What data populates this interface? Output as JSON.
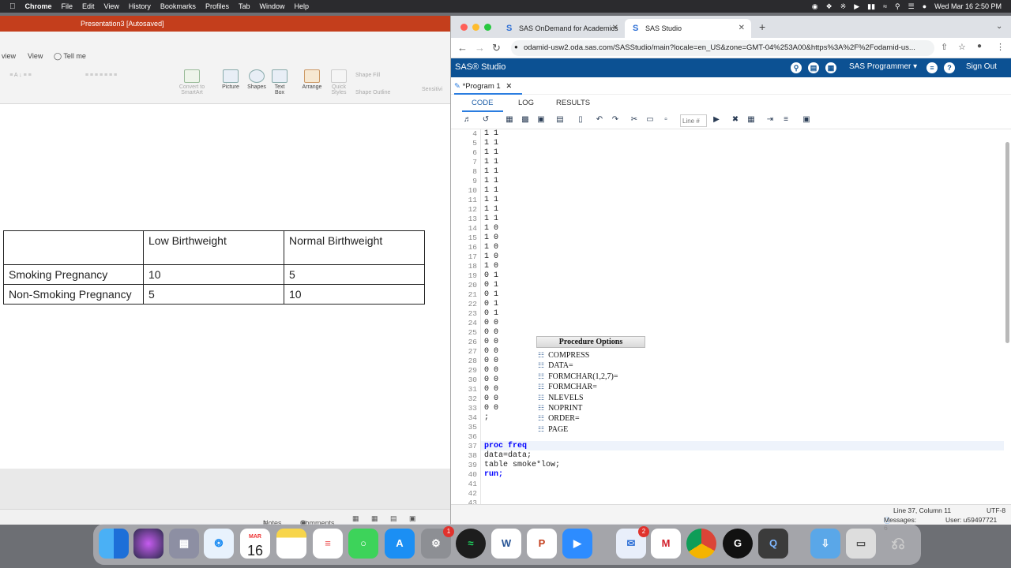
{
  "menubar": {
    "app": "Chrome",
    "items": [
      "File",
      "Edit",
      "View",
      "History",
      "Bookmarks",
      "Profiles",
      "Tab",
      "Window",
      "Help"
    ],
    "clock": "Wed Mar 16  2:50 PM"
  },
  "ppt": {
    "title": "Presentation3 [Autosaved]",
    "tabs": [
      "view",
      "View",
      "Tell me"
    ],
    "ribbon": {
      "convert_smartart": "Convert to SmartArt",
      "picture": "Picture",
      "shapes": "Shapes",
      "text_box": "Text Box",
      "arrange": "Arrange",
      "quick_styles": "Quick Styles",
      "shape_fill": "Shape Fill",
      "shape_outline": "Shape Outline",
      "sensitivity": "Sensitivi"
    },
    "table": {
      "headers": [
        "",
        "Low Birthweight",
        "Normal Birthweight"
      ],
      "rows": [
        [
          "Smoking Pregnancy",
          "10",
          "5"
        ],
        [
          "Non-Smoking Pregnancy",
          "5",
          "10"
        ]
      ]
    },
    "status": {
      "notes": "Notes",
      "comments": "Comments"
    }
  },
  "chrome": {
    "tabs": [
      {
        "label": "SAS OnDemand for Academics"
      },
      {
        "label": "SAS Studio"
      }
    ],
    "url": "odamid-usw2.oda.sas.com/SASStudio/main?locale=en_US&zone=GMT-04%253A00&https%3A%2F%2Fodamid-us..."
  },
  "sas": {
    "logo": "SAS® Studio",
    "role": "SAS Programmer",
    "signout": "Sign Out",
    "program_tab": "*Program 1",
    "subtabs": [
      "CODE",
      "LOG",
      "RESULTS"
    ],
    "line_placeholder": "Line #",
    "lines": [
      {
        "n": "4",
        "t": "1 1"
      },
      {
        "n": "5",
        "t": "1 1"
      },
      {
        "n": "6",
        "t": "1 1"
      },
      {
        "n": "7",
        "t": "1 1"
      },
      {
        "n": "8",
        "t": "1 1"
      },
      {
        "n": "9",
        "t": "1 1"
      },
      {
        "n": "10",
        "t": "1 1"
      },
      {
        "n": "11",
        "t": "1 1"
      },
      {
        "n": "12",
        "t": "1 1"
      },
      {
        "n": "13",
        "t": "1 1"
      },
      {
        "n": "14",
        "t": "1 0"
      },
      {
        "n": "15",
        "t": "1 0"
      },
      {
        "n": "16",
        "t": "1 0"
      },
      {
        "n": "17",
        "t": "1 0"
      },
      {
        "n": "18",
        "t": "1 0"
      },
      {
        "n": "19",
        "t": "0 1"
      },
      {
        "n": "20",
        "t": "0 1"
      },
      {
        "n": "21",
        "t": "0 1"
      },
      {
        "n": "22",
        "t": "0 1"
      },
      {
        "n": "23",
        "t": "0 1"
      },
      {
        "n": "24",
        "t": "0 0"
      },
      {
        "n": "25",
        "t": "0 0"
      },
      {
        "n": "26",
        "t": "0 0"
      },
      {
        "n": "27",
        "t": "0 0"
      },
      {
        "n": "28",
        "t": "0 0"
      },
      {
        "n": "29",
        "t": "0 0"
      },
      {
        "n": "30",
        "t": "0 0"
      },
      {
        "n": "31",
        "t": "0 0"
      },
      {
        "n": "32",
        "t": "0 0"
      },
      {
        "n": "33",
        "t": "0 0"
      },
      {
        "n": "34",
        "t": ";"
      },
      {
        "n": "35",
        "t": ""
      },
      {
        "n": "36",
        "t": ""
      },
      {
        "n": "37",
        "t": "proc freq ",
        "kw": true
      },
      {
        "n": "38",
        "t": "data=data;"
      },
      {
        "n": "39",
        "t": "table smoke*low;"
      },
      {
        "n": "40",
        "t": "run;",
        "kw": true
      },
      {
        "n": "41",
        "t": ""
      },
      {
        "n": "42",
        "t": ""
      },
      {
        "n": "43",
        "t": ""
      }
    ],
    "popup": {
      "title": "Procedure Options",
      "options": [
        "COMPRESS",
        "DATA=",
        "FORMCHAR(1,2,7)=",
        "FORMCHAR=",
        "NLEVELS",
        "NOPRINT",
        "ORDER=",
        "PAGE"
      ]
    },
    "status": {
      "position": "Line 37, Column 11",
      "encoding": "UTF-8",
      "messages": "Messages: 6",
      "user": "User: u59497721"
    }
  },
  "dock": {
    "calendar_month": "MAR",
    "calendar_day": "16",
    "settings_badge": "1",
    "mail_badge": "2"
  }
}
